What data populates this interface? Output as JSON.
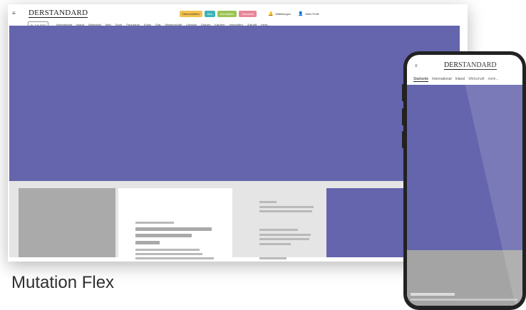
{
  "desktop": {
    "logo": "DERSTANDARD",
    "date_chip": "Fr, 2.9.2022",
    "pills": [
      {
        "label": "Überschriften",
        "color": "#f2c14e"
      },
      {
        "label": "Abo",
        "color": "#3bb3b5"
      },
      {
        "label": "Immobilien",
        "color": "#9bc453"
      },
      {
        "label": "Jobsuche",
        "color": "#e8869a"
      }
    ],
    "links": [
      {
        "icon": "bell-icon",
        "glyph": "🔔",
        "label": "Mitteilungen"
      },
      {
        "icon": "user-icon",
        "glyph": "👤",
        "label": "Mein Profil"
      }
    ],
    "nav": [
      "International",
      "Inland",
      "Wirtschaft",
      "Web",
      "Sport",
      "Panorama",
      "Kultur",
      "Etat",
      "Wissenschaft",
      "Lifestyle",
      "Diskurs",
      "Karriere",
      "Immobilien",
      "Zukunft",
      "mehr..."
    ]
  },
  "phone": {
    "logo": "DERSTANDARD",
    "nav": [
      "Startseite",
      "International",
      "Inland",
      "Wirtschaft",
      "mehr..."
    ]
  },
  "caption": "Mutation Flex",
  "colors": {
    "accent": "#6465ac",
    "gray": "#e5e5e5"
  }
}
